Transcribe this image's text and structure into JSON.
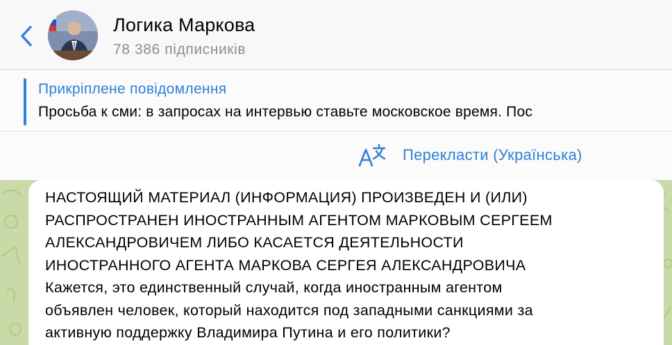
{
  "header": {
    "back_icon": "chevron-left-icon",
    "avatar_icon": "channel-avatar",
    "title": "Логика Маркова",
    "subscribers": "78 386 підписників"
  },
  "pinned": {
    "label": "Прикріплене повідомлення",
    "text": "Просьба к сми: в запросах на интервью ставьте московское время. Пос"
  },
  "translate": {
    "icon": "translate-icon",
    "label": "Перекласти (Українська)"
  },
  "message": {
    "text": "НАСТОЯЩИЙ МАТЕРИАЛ (ИНФОРМАЦИЯ) ПРОИЗВЕДЕН И (ИЛИ)\nРАСПРОСТРАНЕН ИНОСТРАННЫМ АГЕНТОМ МАРКОВЫМ СЕРГЕЕМ\nАЛЕКСАНДРОВИЧЕМ ЛИБО КАСАЕТСЯ ДЕЯТЕЛЬНОСТИ\nИНОСТРАННОГО АГЕНТА МАРКОВА СЕРГЕЯ АЛЕКСАНДРОВИЧА\nКажется, это единственный случай, когда иностранным агентом\nобъявлен человек, который находится под западными санкциями за\nактивную поддержку Владимира Путина и его политики?"
  },
  "colors": {
    "accent": "#2f7fd6",
    "chat_background": "#c9d9a7",
    "subtitle": "#8e8e93"
  }
}
